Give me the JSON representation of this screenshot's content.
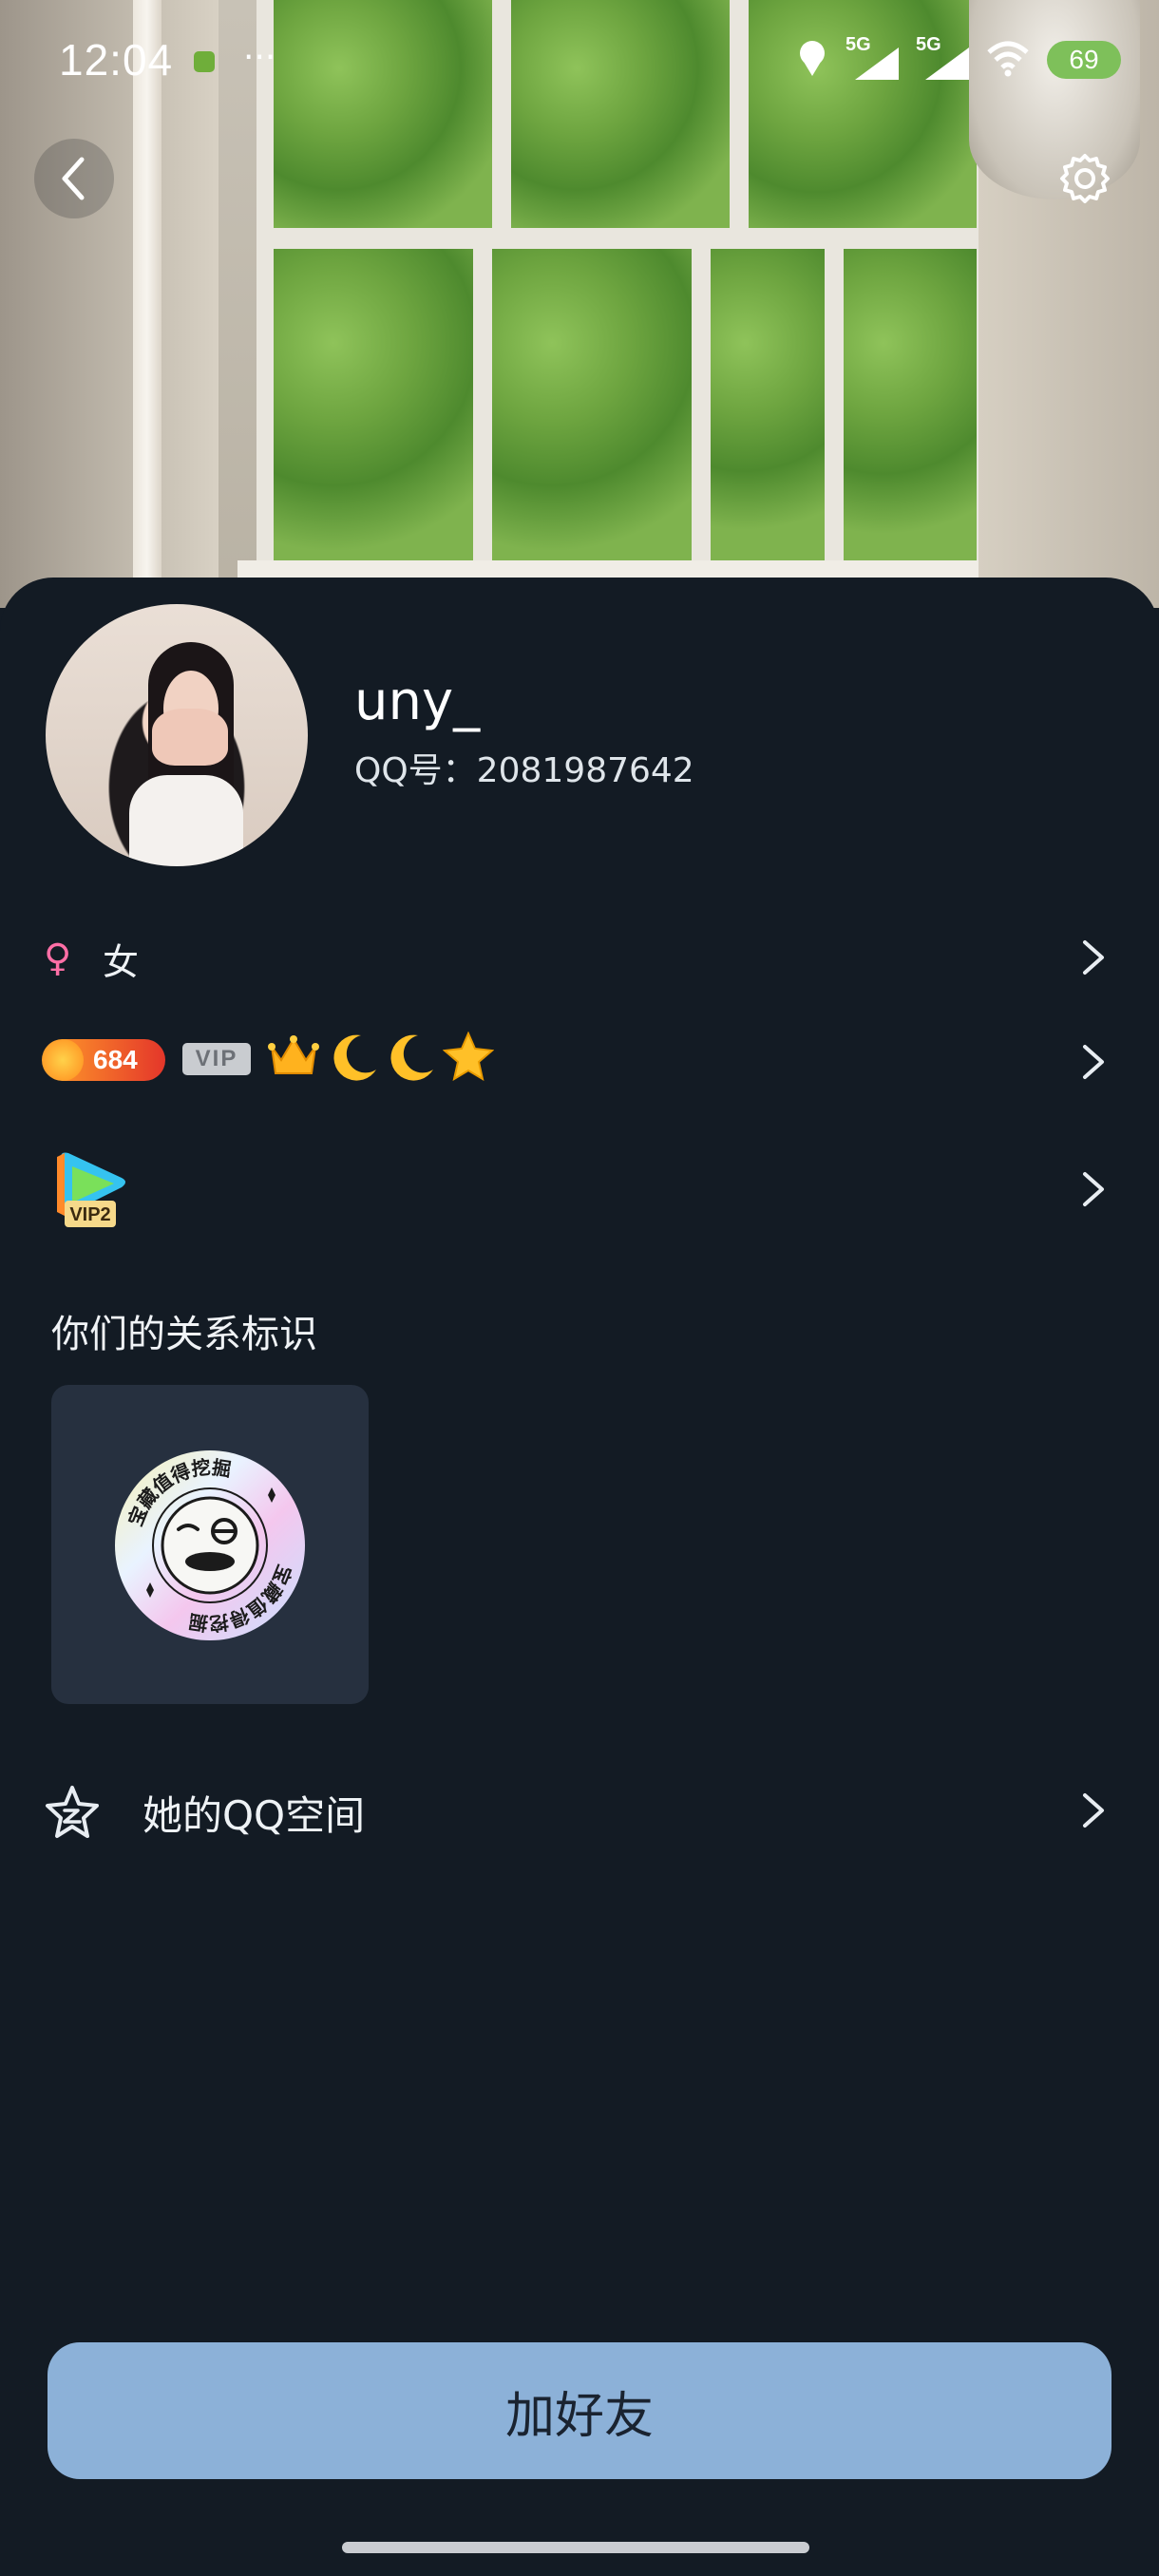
{
  "status_bar": {
    "time": "12:04",
    "dots": "···",
    "network1": "5G",
    "network2": "5G",
    "battery": "69"
  },
  "profile": {
    "nickname": "uny_",
    "qq_number": "QQ号：2081987642",
    "gender_symbol": "♀",
    "gender": "女"
  },
  "badges": {
    "level_value": "684",
    "vip_label": "VIP",
    "icons": [
      "crown-icon",
      "moon-icon",
      "moon-icon",
      "star-icon"
    ]
  },
  "video_vip": {
    "label": "VIP2"
  },
  "relationship": {
    "title": "你们的关系标识",
    "stamp_text": "宝藏值得挖掘"
  },
  "qzone": {
    "label": "她的QQ空间"
  },
  "actions": {
    "add_friend": "加好友"
  },
  "colors": {
    "background": "#131b24",
    "button": "#8cb1d8",
    "card": "#26303f",
    "gender_female": "#ff6fa6"
  }
}
